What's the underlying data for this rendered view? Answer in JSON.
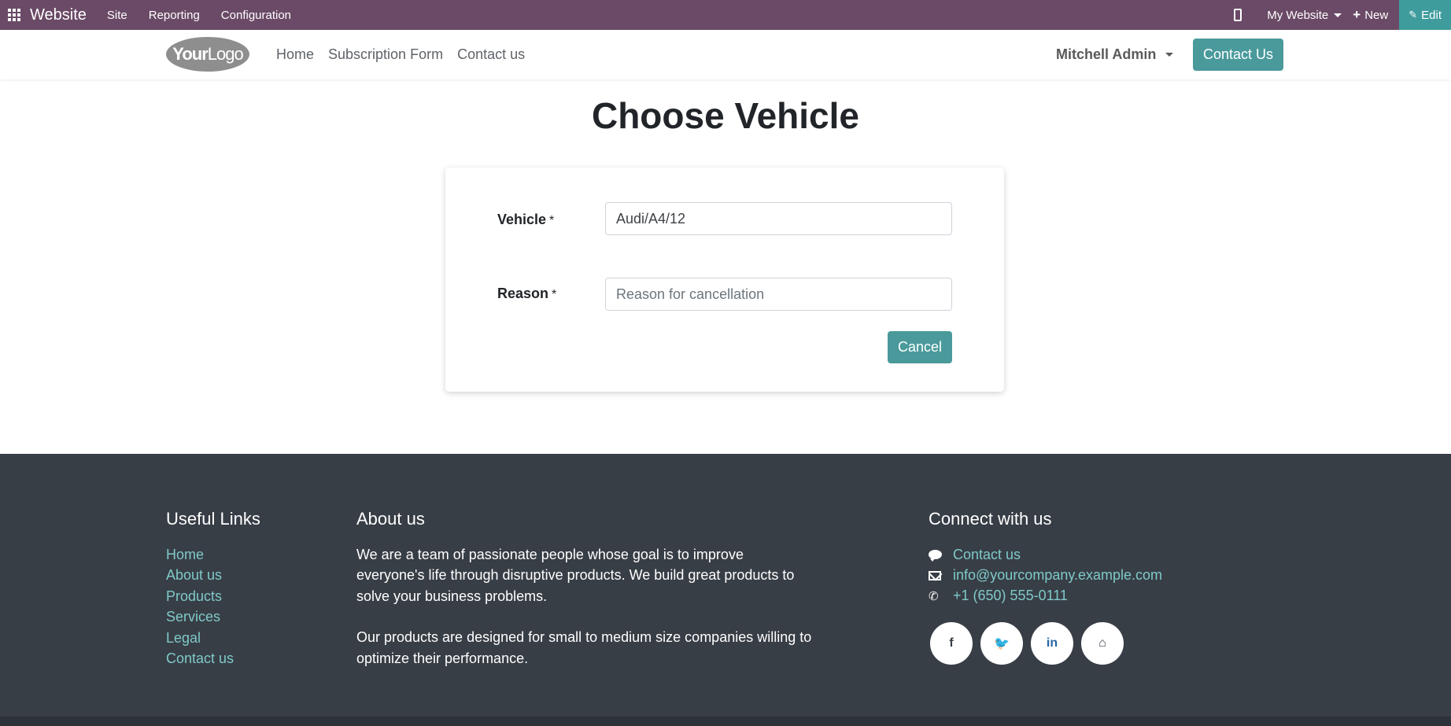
{
  "adminbar": {
    "brand": "Website",
    "menu": [
      "Site",
      "Reporting",
      "Configuration"
    ],
    "website_selector": "My Website",
    "new_label": "New",
    "edit_label": "Edit"
  },
  "header": {
    "logo_bold": "Your",
    "logo_light": "Logo",
    "nav": [
      "Home",
      "Subscription Form",
      "Contact us"
    ],
    "user": "Mitchell Admin",
    "contact_button": "Contact Us"
  },
  "main": {
    "title": "Choose Vehicle",
    "vehicle_label": "Vehicle",
    "vehicle_value": "Audi/A4/12",
    "reason_label": "Reason",
    "reason_placeholder": "Reason for cancellation",
    "required_mark": "*",
    "cancel_button": "Cancel"
  },
  "footer": {
    "useful_links_title": "Useful Links",
    "useful_links": [
      "Home",
      "About us",
      "Products",
      "Services",
      "Legal",
      "Contact us"
    ],
    "about_title": "About us",
    "about_p1": "We are a team of passionate people whose goal is to improve everyone's life through disruptive products. We build great products to solve your business problems.",
    "about_p2": "Our products are designed for small to medium size companies willing to optimize their performance.",
    "connect_title": "Connect with us",
    "contact_link": "Contact us",
    "email": "info@yourcompany.example.com",
    "phone": "+1 (650) 555-0111",
    "socials": [
      "facebook-icon",
      "twitter-icon",
      "linkedin-icon",
      "home-icon"
    ]
  },
  "colors": {
    "adminbar": "#6a4a66",
    "accent": "#4a9a9c",
    "footer": "#383e46",
    "footer_link": "#7fc9c9"
  }
}
